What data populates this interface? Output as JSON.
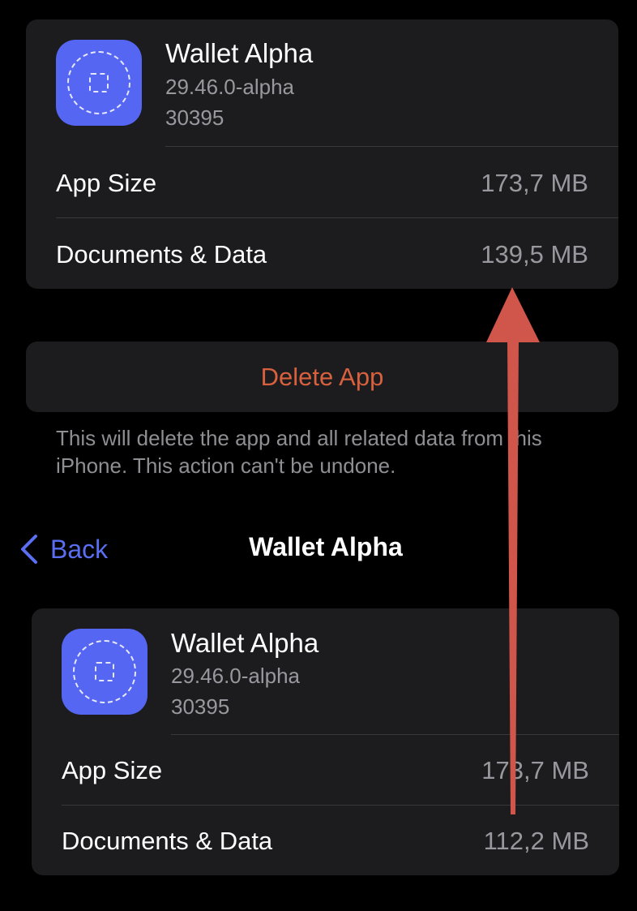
{
  "top_card": {
    "app_name": "Wallet Alpha",
    "version": "29.46.0-alpha",
    "build": "30395",
    "app_size_label": "App Size",
    "app_size_value": "173,7 MB",
    "docs_label": "Documents & Data",
    "docs_value": "139,5 MB"
  },
  "delete": {
    "label": "Delete App",
    "footnote": "This will delete the app and all related data from this iPhone. This action can't be undone."
  },
  "nav": {
    "back_label": "Back",
    "title": "Wallet Alpha"
  },
  "bottom_card": {
    "app_name": "Wallet Alpha",
    "version": "29.46.0-alpha",
    "build": "30395",
    "app_size_label": "App Size",
    "app_size_value": "173,7 MB",
    "docs_label": "Documents & Data",
    "docs_value": "112,2 MB"
  },
  "colors": {
    "background": "#000000",
    "card": "#1c1c1e",
    "app_icon": "#5566f2",
    "destructive": "#d7613e",
    "link": "#5a6ef2",
    "secondary_text": "#98989e",
    "annotation_arrow": "#d0554a"
  },
  "icons": {
    "back": "chevron-left-icon",
    "app": "app-placeholder-icon",
    "annotation": "up-arrow-annotation"
  }
}
